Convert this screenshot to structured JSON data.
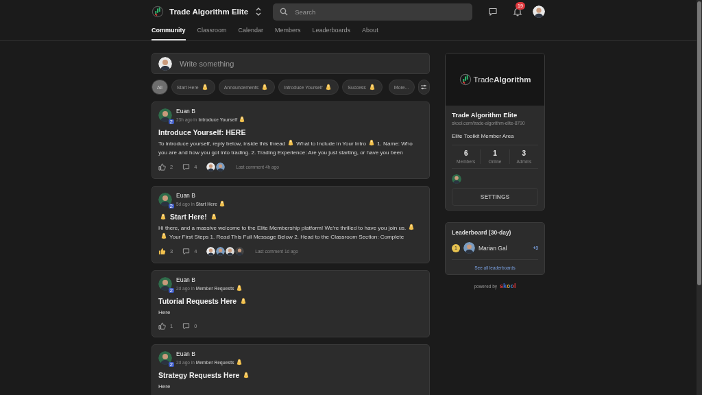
{
  "header": {
    "group_name": "Trade Algorithm Elite",
    "search": {
      "placeholder": "Search"
    },
    "notifications": "19"
  },
  "tabs": [
    {
      "label": "Community",
      "selected": true
    },
    {
      "label": "Classroom",
      "selected": false
    },
    {
      "label": "Calendar",
      "selected": false
    },
    {
      "label": "Members",
      "selected": false
    },
    {
      "label": "Leaderboards",
      "selected": false
    },
    {
      "label": "About",
      "selected": false
    }
  ],
  "composer": {
    "placeholder": "Write something"
  },
  "categories": [
    {
      "label": "All",
      "selected": true,
      "emoji": false
    },
    {
      "label": "Start Here",
      "selected": false,
      "emoji": true
    },
    {
      "label": "Announcements",
      "selected": false,
      "emoji": true
    },
    {
      "label": "Introduce Yourself",
      "selected": false,
      "emoji": true
    },
    {
      "label": "Success",
      "selected": false,
      "emoji": true
    },
    {
      "label": "More...",
      "selected": false,
      "emoji": false
    }
  ],
  "posts": [
    {
      "author": "Euan B",
      "level": "2",
      "time": "23h ago in",
      "category": "Introduce Yourself",
      "category_emoji": true,
      "title": [
        {
          "kind": "text",
          "text": "Introduce Yourself: HERE"
        }
      ],
      "body": [
        {
          "kind": "text",
          "text": "To introduce yourself, reply below, inside this thread"
        },
        {
          "kind": "emoji"
        },
        {
          "kind": "text",
          "text": "What to Include in Your Intro"
        },
        {
          "kind": "emoji"
        },
        {
          "kind": "text",
          "text": "1. Name: Who you are and how you got into trading. 2. Trading Experience: Are you just starting, or have you been"
        }
      ],
      "likes": "2",
      "liked": false,
      "comments": "4",
      "commenters": [
        {
          "kind": "avatar"
        },
        {
          "kind": "avatar"
        }
      ],
      "last_comment": "Last comment 4h ago"
    },
    {
      "author": "Euan B",
      "level": "2",
      "time": "5d ago in",
      "category": "Start Here",
      "category_emoji": true,
      "title": [
        {
          "kind": "emoji"
        },
        {
          "kind": "text",
          "text": "Start Here!"
        },
        {
          "kind": "emoji"
        }
      ],
      "body": [
        {
          "kind": "text",
          "text": "Hi there, and a massive welcome to the Elite Membership platform! We're thrilled to have you join us."
        },
        {
          "kind": "emoji"
        },
        {
          "kind": "emoji"
        },
        {
          "kind": "text",
          "text": "Your First Steps 1. Read This Full Message Below 2. Head to the Classroom Section: Complete"
        }
      ],
      "likes": "3",
      "liked": true,
      "comments": "4",
      "commenters": [
        {
          "kind": "avatar"
        },
        {
          "kind": "avatar"
        },
        {
          "kind": "avatar"
        },
        {
          "kind": "avatar"
        }
      ],
      "last_comment": "Last comment 1d ago"
    },
    {
      "author": "Euan B",
      "level": "2",
      "time": "2d ago in",
      "category": "Member Requests",
      "category_emoji": true,
      "title": [
        {
          "kind": "text",
          "text": "Tutorial Requests Here"
        },
        {
          "kind": "emoji"
        }
      ],
      "body": [
        {
          "kind": "text",
          "text": "Here"
        }
      ],
      "likes": "1",
      "liked": false,
      "comments": "0"
    },
    {
      "author": "Euan B",
      "level": "2",
      "time": "2d ago in",
      "category": "Member Requests",
      "category_emoji": true,
      "title": [
        {
          "kind": "text",
          "text": "Strategy Requests Here"
        },
        {
          "kind": "emoji"
        }
      ],
      "body": [
        {
          "kind": "text",
          "text": "Here"
        }
      ]
    }
  ],
  "group_card": {
    "logo": "Trade**Algorithm**",
    "name": "Trade Algorithm Elite",
    "url": "skool.com/trade-algorithm-elite-8790",
    "description": "Elite Toolkit Member Area",
    "stats": [
      {
        "value": "6",
        "label": "Members"
      },
      {
        "value": "1",
        "label": "Online"
      },
      {
        "value": "3",
        "label": "Admins"
      }
    ],
    "button": "SETTINGS"
  },
  "leaderboard": {
    "title": "Leaderboard (30-day)",
    "entries": [
      {
        "rank": "1",
        "name": "Marian Gal",
        "points": "+3"
      }
    ],
    "link": "See all leaderboards"
  },
  "footer": {
    "powered_by": "powered by",
    "brand": "skool"
  }
}
